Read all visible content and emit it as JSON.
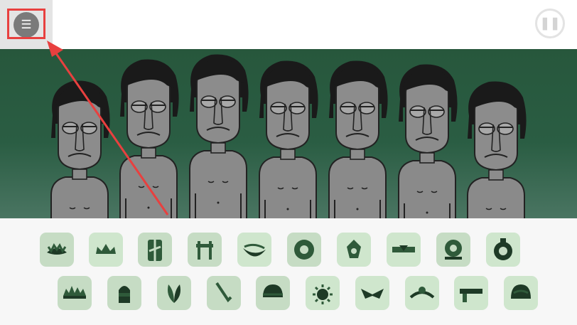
{
  "toolbar": {
    "menu_icon": "menu-icon",
    "menu_glyph": "☰",
    "pause_icon": "pause-icon",
    "pause_glyph": "❚❚"
  },
  "stage": {
    "background": "#2a5d43",
    "characters": [
      "character-1",
      "character-2",
      "character-3",
      "character-4",
      "character-5",
      "character-6",
      "character-7"
    ]
  },
  "annotation": {
    "color": "#e8403f"
  },
  "sounds": {
    "row1": [
      "crown-icon",
      "crown-spiked-icon",
      "cross-pattern-icon",
      "posts-icon",
      "brim-icon",
      "ring-badge-icon",
      "gem-icon",
      "belt-icon",
      "spiral-icon",
      "bell-icon"
    ],
    "row2": [
      "grass-crown-icon",
      "bell-shape-icon",
      "leaves-icon",
      "branch-icon",
      "dome-cap-icon",
      "sun-icon",
      "bowtie-icon",
      "clasp-icon",
      "band-icon",
      "helmet-icon"
    ]
  },
  "colors": {
    "tile": "#c6dcc4",
    "icon": "#2f5a3a",
    "dark": "#1e3a26",
    "highlight": "#e8403f"
  }
}
